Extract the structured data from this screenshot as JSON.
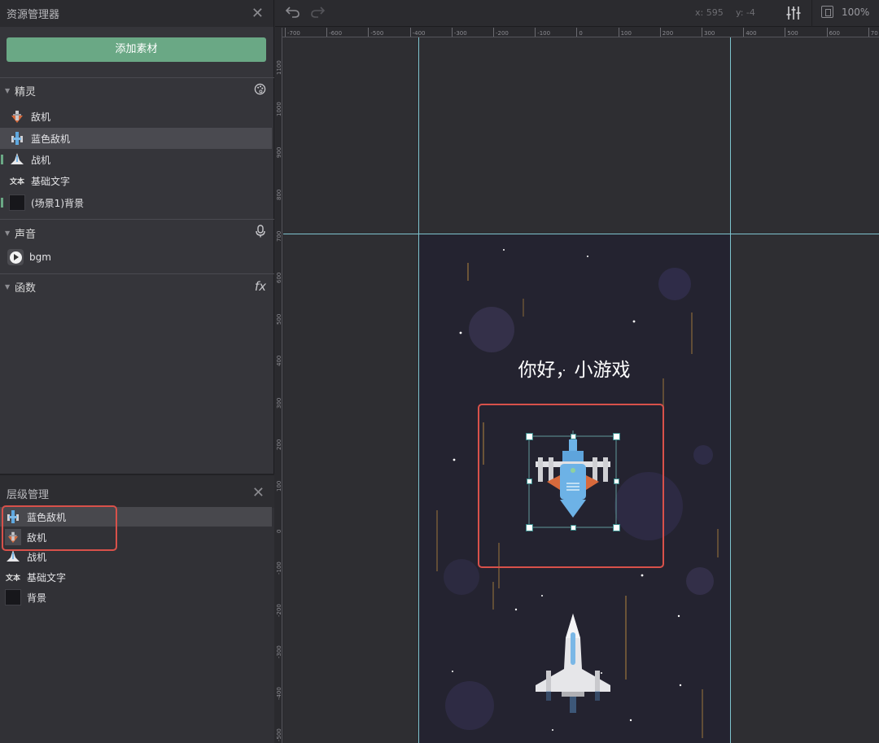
{
  "resource_panel": {
    "title": "资源管理器",
    "add_button": "添加素材",
    "sprites_section": {
      "label": "精灵",
      "icon": "palette-icon",
      "items": [
        {
          "label": "敌机",
          "icon": "enemy-plane-icon"
        },
        {
          "label": "蓝色敌机",
          "icon": "blue-enemy-plane-icon",
          "selected": true
        },
        {
          "label": "战机",
          "icon": "fighter-plane-icon"
        },
        {
          "label": "基础文字",
          "icon": "text-icon",
          "thumb_text": "文本"
        },
        {
          "label": "(场景1)背景",
          "icon": "background-icon"
        }
      ]
    },
    "sound_section": {
      "label": "声音",
      "icon": "microphone-icon",
      "items": [
        {
          "label": "bgm",
          "icon": "play-icon"
        }
      ]
    },
    "functions_section": {
      "label": "函数",
      "icon": "fx-icon",
      "icon_text": "fx"
    }
  },
  "layer_panel": {
    "title": "层级管理",
    "items": [
      {
        "label": "蓝色敌机",
        "selected": true
      },
      {
        "label": "敌机"
      },
      {
        "label": "战机"
      },
      {
        "label": "基础文字",
        "thumb_text": "文本"
      },
      {
        "label": "背景"
      }
    ]
  },
  "toolbar": {
    "undo_icon": "undo-icon",
    "redo_icon": "redo-icon",
    "coord_x": "x: 595",
    "coord_y": "y: -4",
    "mixer_icon": "sliders-icon",
    "fit_icon": "fit-screen-icon",
    "zoom": "100%"
  },
  "rulers": {
    "horizontal": [
      "-700",
      "-600",
      "-500",
      "-400",
      "-300",
      "-200",
      "-100",
      "0",
      "100",
      "200",
      "300",
      "400",
      "500",
      "600",
      "70"
    ],
    "vertical": [
      "1100",
      "1000",
      "900",
      "800",
      "700",
      "600",
      "500",
      "400",
      "300",
      "200",
      "100",
      "0",
      "-100",
      "-200",
      "-300",
      "-400",
      "-500"
    ]
  },
  "scene": {
    "title_text": "你好，小游戏"
  },
  "colors": {
    "accent_green": "#6aa885",
    "highlight_red": "#d8514a",
    "guide_cyan": "#7ec4cf",
    "scene_bg": "#242330"
  }
}
